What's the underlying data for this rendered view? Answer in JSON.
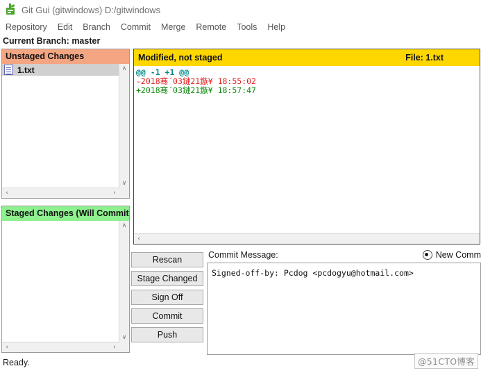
{
  "window": {
    "title": "Git Gui (gitwindows) D:/gitwindows",
    "icon": "git-logo-icon"
  },
  "menubar": {
    "items": [
      {
        "label": "Repository"
      },
      {
        "label": "Edit"
      },
      {
        "label": "Branch"
      },
      {
        "label": "Commit"
      },
      {
        "label": "Merge"
      },
      {
        "label": "Remote"
      },
      {
        "label": "Tools"
      },
      {
        "label": "Help"
      }
    ]
  },
  "branch_bar": {
    "text": "Current Branch: master"
  },
  "unstaged": {
    "header": "Unstaged Changes",
    "header_color": "#f4a582",
    "files": [
      {
        "name": "1.txt",
        "icon": "text-file-icon"
      }
    ]
  },
  "staged": {
    "header": "Staged Changes (Will Commit)",
    "header_color": "#8ef08e",
    "files": []
  },
  "diff": {
    "status": "Modified, not staged",
    "file_label": "File:  1.txt",
    "header_color": "#ffd700",
    "lines": [
      {
        "type": "hunk",
        "text": "@@ -1 +1 @@",
        "color": "#008b8b"
      },
      {
        "type": "removed",
        "text": "-2018骞´03鏈21鏃¥ 18:55:02",
        "color": "#e02020"
      },
      {
        "type": "added",
        "text": "+2018骞´03鏈21鏃¥ 18:57:47",
        "color": "#108a10"
      }
    ]
  },
  "buttons": [
    {
      "label": "Rescan",
      "name": "rescan-button"
    },
    {
      "label": "Stage Changed",
      "name": "stage-changed-button"
    },
    {
      "label": "Sign Off",
      "name": "sign-off-button"
    },
    {
      "label": "Commit",
      "name": "commit-button"
    },
    {
      "label": "Push",
      "name": "push-button"
    }
  ],
  "commit": {
    "label": "Commit Message:",
    "radio_label": "New Comm",
    "message": "Signed-off-by: Pcdog <pcdogyu@hotmail.com>"
  },
  "status_bar": {
    "text": "Ready."
  },
  "watermark": {
    "text": "@51CTO博客"
  },
  "scrollbars": {
    "up": "∧",
    "down": "∨",
    "left": "‹",
    "right": "›"
  }
}
